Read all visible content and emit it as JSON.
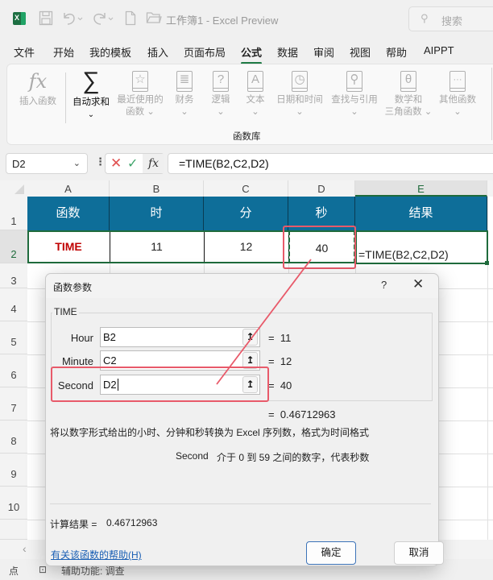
{
  "app": {
    "window_title": "工作簿1 - Excel Preview",
    "search_placeholder": "搜索",
    "logo_letter": "X"
  },
  "quick_access": {
    "icons": [
      "save-icon",
      "undo-icon",
      "redo-icon",
      "new-file-icon",
      "open-folder-icon",
      "customize-icon"
    ]
  },
  "menu": {
    "tabs": [
      {
        "label": "文件",
        "active": false
      },
      {
        "label": "开始",
        "active": false
      },
      {
        "label": "我的模板",
        "active": false
      },
      {
        "label": "插入",
        "active": false
      },
      {
        "label": "页面布局",
        "active": false
      },
      {
        "label": "公式",
        "active": true
      },
      {
        "label": "数据",
        "active": false
      },
      {
        "label": "审阅",
        "active": false
      },
      {
        "label": "视图",
        "active": false
      },
      {
        "label": "帮助",
        "active": false
      },
      {
        "label": "AIPPT",
        "active": false
      }
    ]
  },
  "ribbon": {
    "group_label": "函数库",
    "items": [
      {
        "label": "插入函数",
        "label2": "",
        "icon": "fx",
        "enabled": false
      },
      {
        "label": "自动求和",
        "label2": "⌄",
        "icon": "∑",
        "enabled": true
      },
      {
        "label": "最近使用的",
        "label2": "函数 ⌄",
        "icon": "☆",
        "enabled": false
      },
      {
        "label": "财务",
        "label2": "⌄",
        "icon": "≣",
        "enabled": false
      },
      {
        "label": "逻辑",
        "label2": "⌄",
        "icon": "?",
        "enabled": false
      },
      {
        "label": "文本",
        "label2": "⌄",
        "icon": "A",
        "enabled": false
      },
      {
        "label": "日期和时间",
        "label2": "⌄",
        "icon": "◷",
        "enabled": false
      },
      {
        "label": "查找与引用",
        "label2": "⌄",
        "icon": "⚲",
        "enabled": false
      },
      {
        "label": "数学和",
        "label2": "三角函数 ⌄",
        "icon": "θ",
        "enabled": false
      },
      {
        "label": "其他函数",
        "label2": "⌄",
        "icon": "···",
        "enabled": false
      }
    ]
  },
  "formula_bar": {
    "name_box": "D2",
    "cancel_symbol": "✕",
    "enter_symbol": "✓",
    "fx_symbol": "fx",
    "formula": "=TIME(B2,C2,D2)"
  },
  "sheet": {
    "columns": [
      "A",
      "B",
      "C",
      "D",
      "E"
    ],
    "rows": [
      "1",
      "2",
      "3",
      "4",
      "5",
      "6",
      "7",
      "8",
      "9",
      "10"
    ],
    "header_row": [
      "函数",
      "时",
      "分",
      "秒",
      "结果"
    ],
    "data_row": [
      "TIME",
      "11",
      "12",
      "40",
      "=TIME(B2,C2,D2)"
    ],
    "header_color": "#0e6e99",
    "function_name_color": "#c00000"
  },
  "dialog": {
    "title": "函数参数",
    "help_symbol": "?",
    "close_symbol": "✕",
    "function_name": "TIME",
    "args": [
      {
        "label": "Hour",
        "value": "B2",
        "result": "11"
      },
      {
        "label": "Minute",
        "value": "C2",
        "result": "12"
      },
      {
        "label": "Second",
        "value": "D2",
        "result": "40"
      }
    ],
    "eq": "=",
    "formula_result": "0.46712963",
    "description": "将以数字形式给出的小时、分钟和秒转换为 Excel 序列数，格式为时间格式",
    "arg_help_name": "Second",
    "arg_help_text": "介于 0 到 59 之间的数字，代表秒数",
    "calc_result_label": "计算结果 =",
    "calc_result_value": "0.46712963",
    "help_link": "有关该函数的帮助(H)",
    "ok_label": "确定",
    "cancel_label": "取消"
  },
  "status_bar": {
    "mode": "点",
    "accessibility": "辅助功能: 调查"
  },
  "annotation_color": "#e85a6a"
}
